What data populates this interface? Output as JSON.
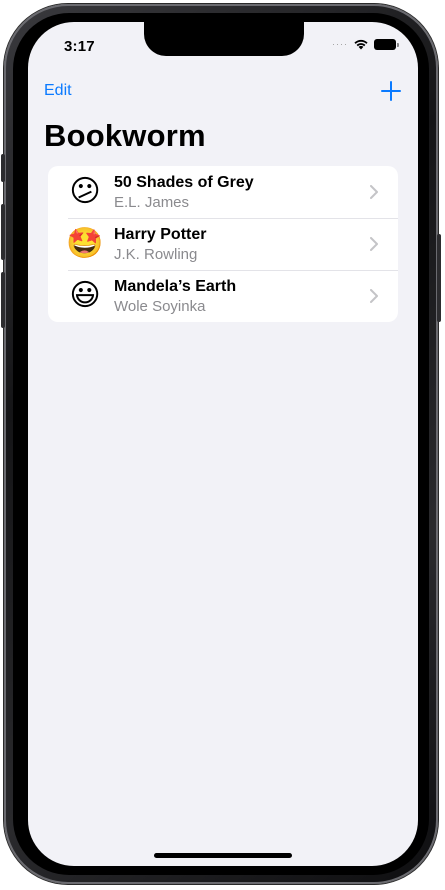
{
  "status_bar": {
    "time": "3:17",
    "signal_icon": "signal-dots-icon",
    "wifi_icon": "wifi-icon",
    "battery_icon": "battery-icon"
  },
  "nav": {
    "edit_label": "Edit",
    "add_icon": "plus-icon",
    "title": "Bookworm"
  },
  "books": [
    {
      "emoji": "😕",
      "title": "50 Shades of Grey",
      "author": "E.L. James"
    },
    {
      "emoji": "🤩",
      "title": "Harry Potter",
      "author": "J.K. Rowling"
    },
    {
      "emoji": "😃",
      "title": "Mandela’s Earth",
      "author": "Wole Soyinka"
    }
  ],
  "colors": {
    "accent": "#0a7aff",
    "background": "#f2f2f7",
    "secondary_text": "#8a8a8e"
  }
}
